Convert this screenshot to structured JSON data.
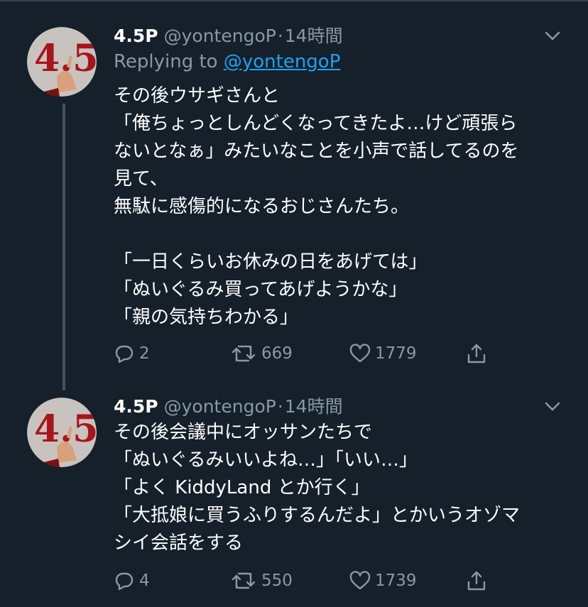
{
  "tweets": [
    {
      "name": "4.5P",
      "handle": "@yontengoP",
      "separator": "·",
      "time": "14時間",
      "replying_prefix": "Replying to",
      "replying_handle": "@yontengoP",
      "text": "その後ウサギさんと\n「俺ちょっとしんどくなってきたよ…けど頑張ら\nないとなぁ」みたいなことを小声で話してるのを\n見て、\n無駄に感傷的になるおじさんたち。\n\n「一日くらいお休みの日をあげては」\n「ぬいぐるみ買ってあげようかな」\n「親の気持ちわかる」",
      "replies": "2",
      "retweets": "669",
      "likes": "1779"
    },
    {
      "name": "4.5P",
      "handle": "@yontengoP",
      "separator": "·",
      "time": "14時間",
      "text": "その後会議中にオッサンたちで\n「ぬいぐるみいいよね…」「いい…」\n「よく KiddyLand とか行く」\n「大抵娘に買うふりするんだよ」とかいうオゾマ\nシイ会話をする",
      "replies": "4",
      "retweets": "550",
      "likes": "1739"
    }
  ],
  "avatar_text": "4.5",
  "icons": [
    "reply-icon",
    "retweet-icon",
    "like-icon",
    "share-icon",
    "chevron-down-icon"
  ],
  "colors": {
    "background": "#15202b",
    "secondary_text": "#8899a6",
    "link": "#1da1f2",
    "thread_line": "#3d5466"
  }
}
